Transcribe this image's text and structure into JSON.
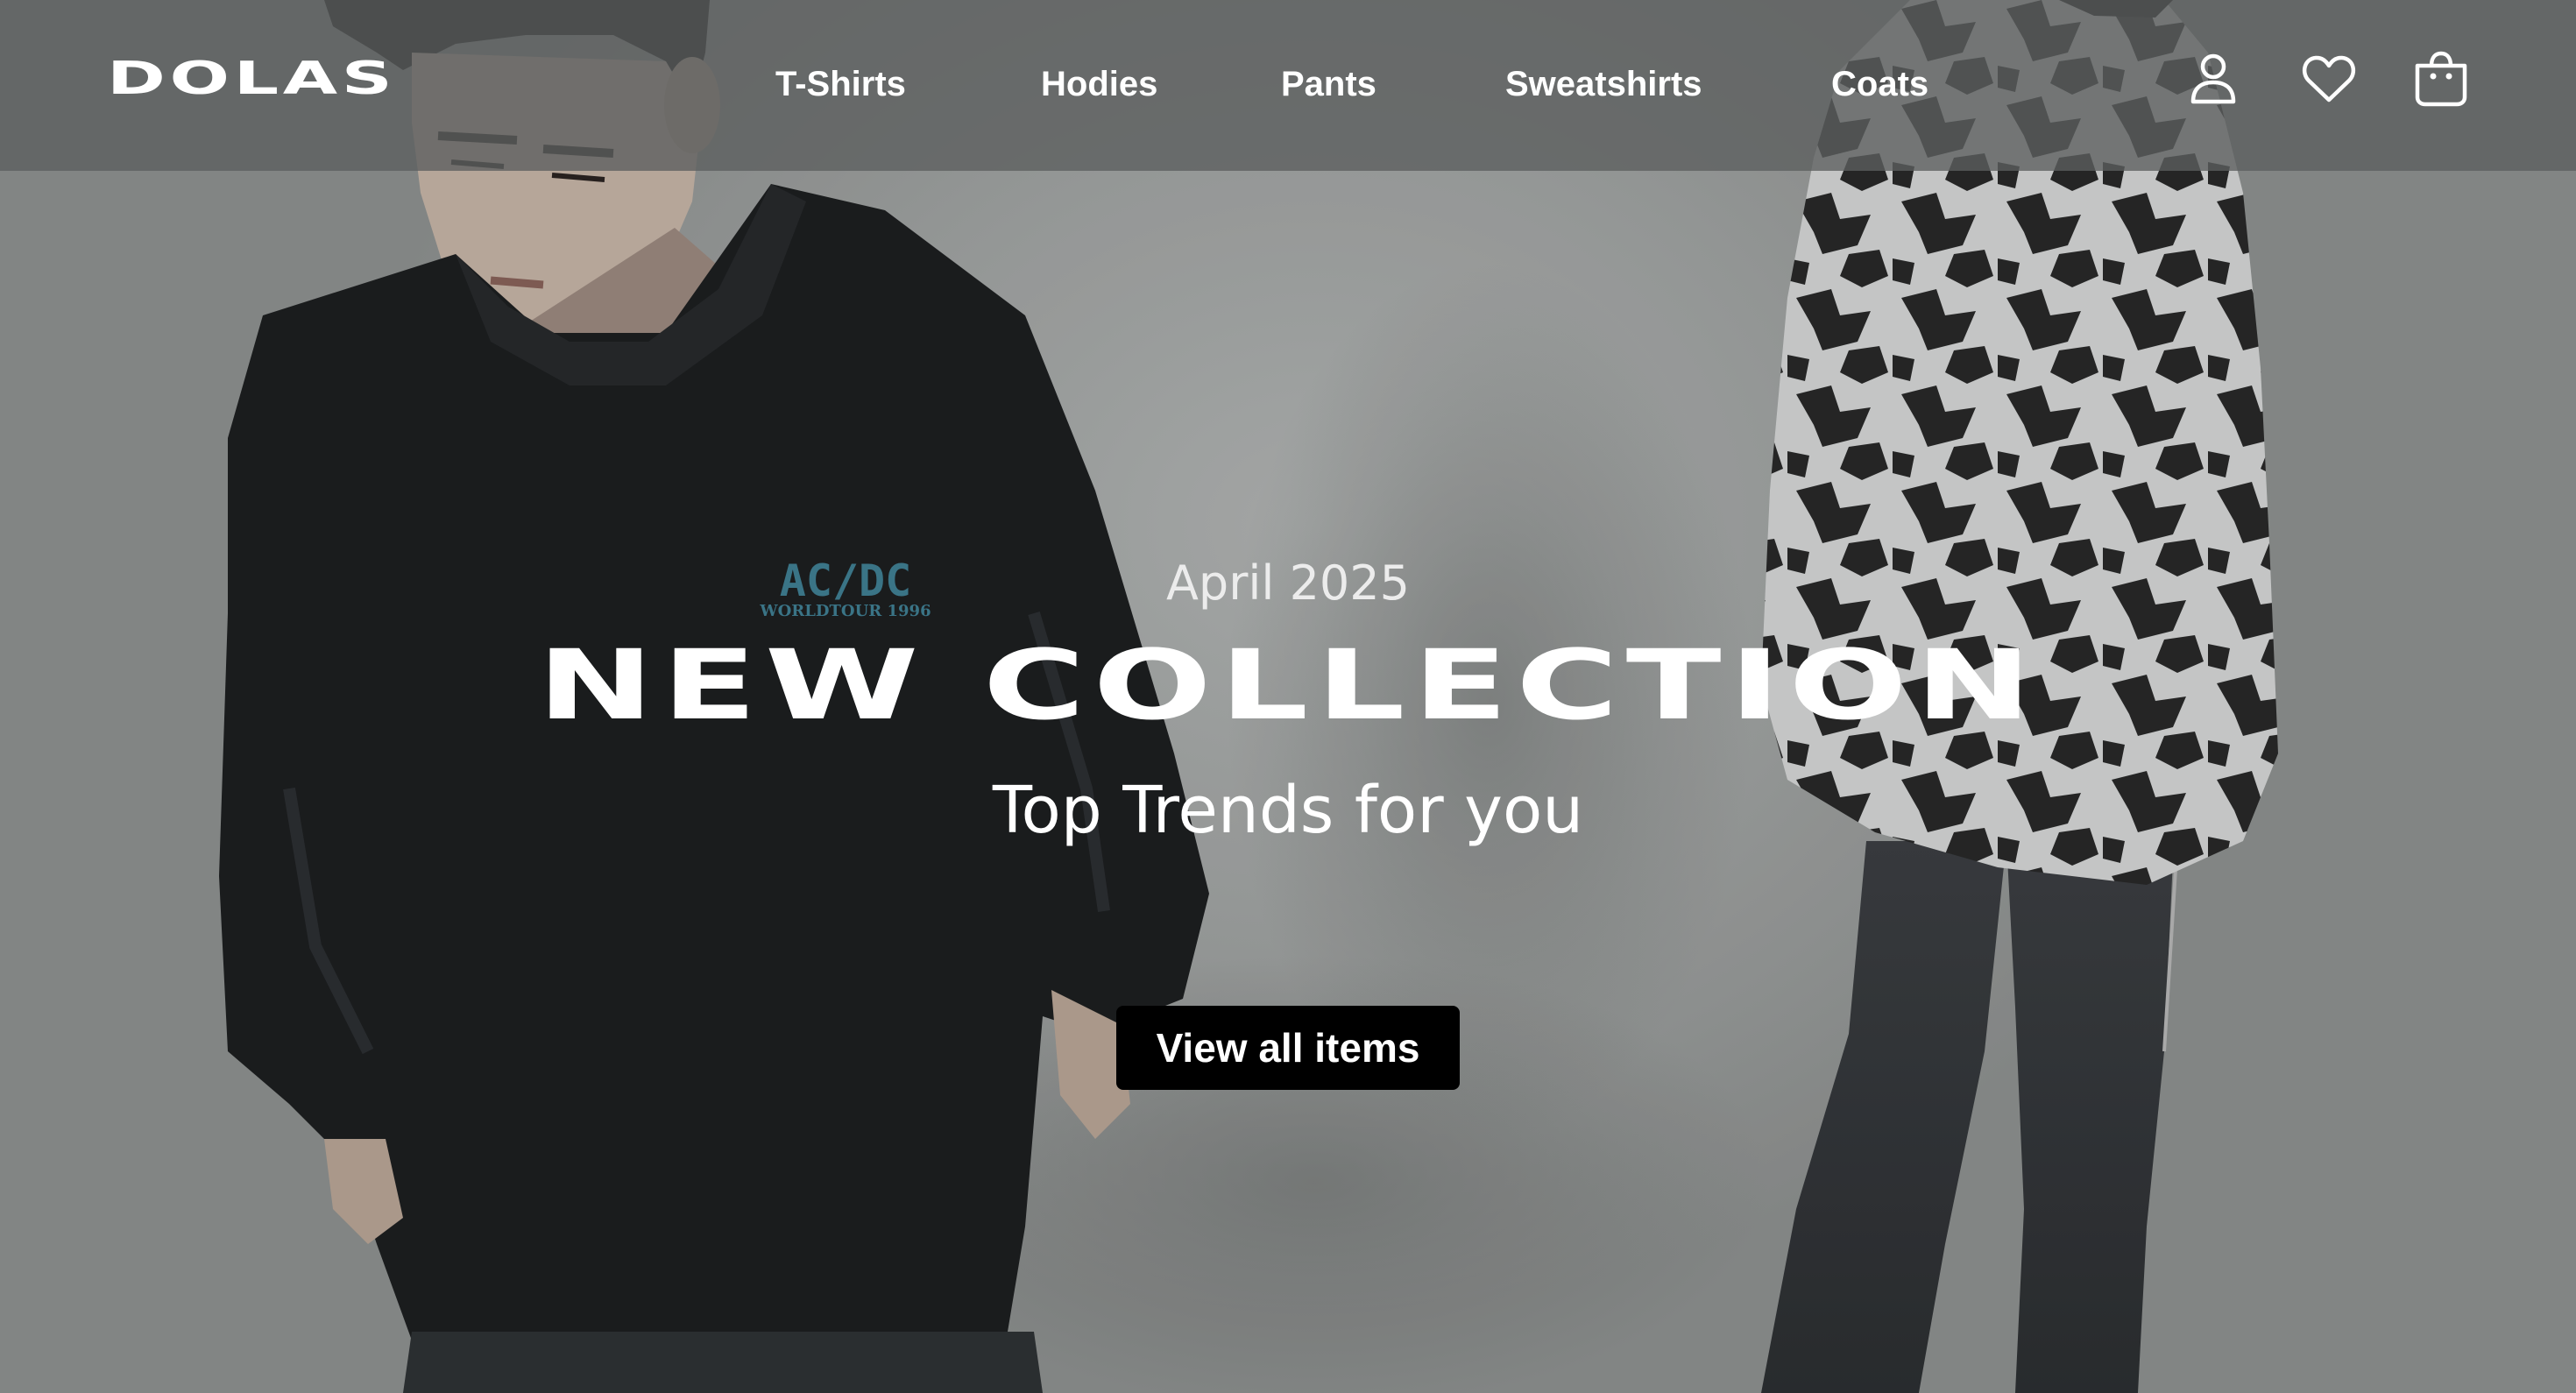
{
  "brand": {
    "logo_text": "DOLAS"
  },
  "nav": {
    "items": [
      {
        "label": "T-Shirts"
      },
      {
        "label": "Hodies"
      },
      {
        "label": "Pants"
      },
      {
        "label": "Sweatshirts"
      },
      {
        "label": "Coats"
      }
    ]
  },
  "header_icons": [
    {
      "name": "account-icon"
    },
    {
      "name": "wishlist-heart-icon"
    },
    {
      "name": "shopping-bag-icon"
    }
  ],
  "hero": {
    "date": "April 2025",
    "title": "NEW COLLECTION",
    "subtitle": "Top Trends for you",
    "cta_label": "View all items",
    "sweatshirt_print": {
      "line1": "AC/DC",
      "line2": "WORLDTOUR 1996"
    }
  },
  "colors": {
    "header_bg": "#5c5f5f",
    "text_primary": "#ffffff",
    "cta_bg": "#000000",
    "background": "#9da09f"
  }
}
